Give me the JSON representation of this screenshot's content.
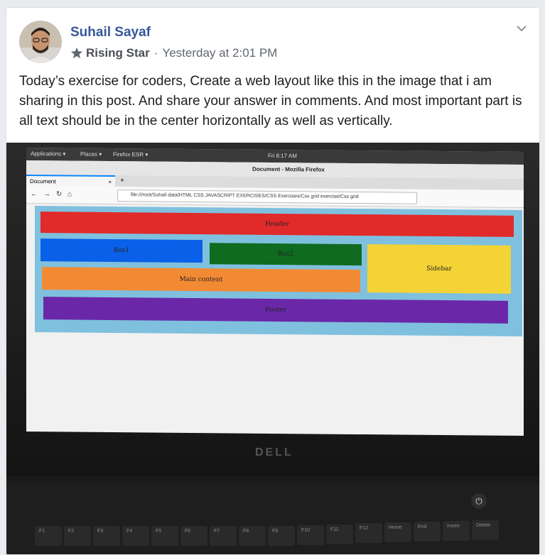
{
  "post": {
    "author": "Suhail Sayaf",
    "badge": "Rising Star",
    "separator": "·",
    "timestamp": "Yesterday at 2:01 PM",
    "text": "Today’s exercise for coders, Create a web layout like this in the image that i am sharing in this post. And share your answer in comments. And most important part is all text should be in the center horizontally as well as vertically."
  },
  "photo": {
    "topbar": {
      "applications": "Applications ▾",
      "places": "Places ▾",
      "firefox": "Firefox ESR ▾",
      "clock": "Fri 8:17 AM"
    },
    "window_title": "Document - Mozilla Firefox",
    "tab_label": "Document",
    "tab_close": "×",
    "new_tab": "+",
    "url": "file:///root/Suhail data/HTML CSS JAVASCRIPT EXERCISES/CSS Exercises/Css grid exercise/Css grid",
    "layout": {
      "header": "Header",
      "box1": "Box1",
      "box2": "Box2",
      "sidebar": "Sidebar",
      "main": "Main content",
      "footer": "Footer"
    },
    "brand": "DELL",
    "keys": [
      "F1",
      "F2",
      "F3",
      "F4",
      "F5",
      "F6",
      "F7",
      "F8",
      "F9",
      "F10",
      "F11",
      "F12",
      "Home",
      "End",
      "Insert",
      "Delete"
    ]
  },
  "colors": {
    "author_link": "#365899",
    "header": "#e12a2a",
    "box1": "#0a60e8",
    "box2": "#0f6b1f",
    "sidebar": "#f3d336",
    "main": "#f28a34",
    "footer": "#6a28a8",
    "page_bg": "#7fc0de"
  },
  "icons": {
    "badge": "star-badge-icon",
    "menu": "chevron-down-icon"
  }
}
